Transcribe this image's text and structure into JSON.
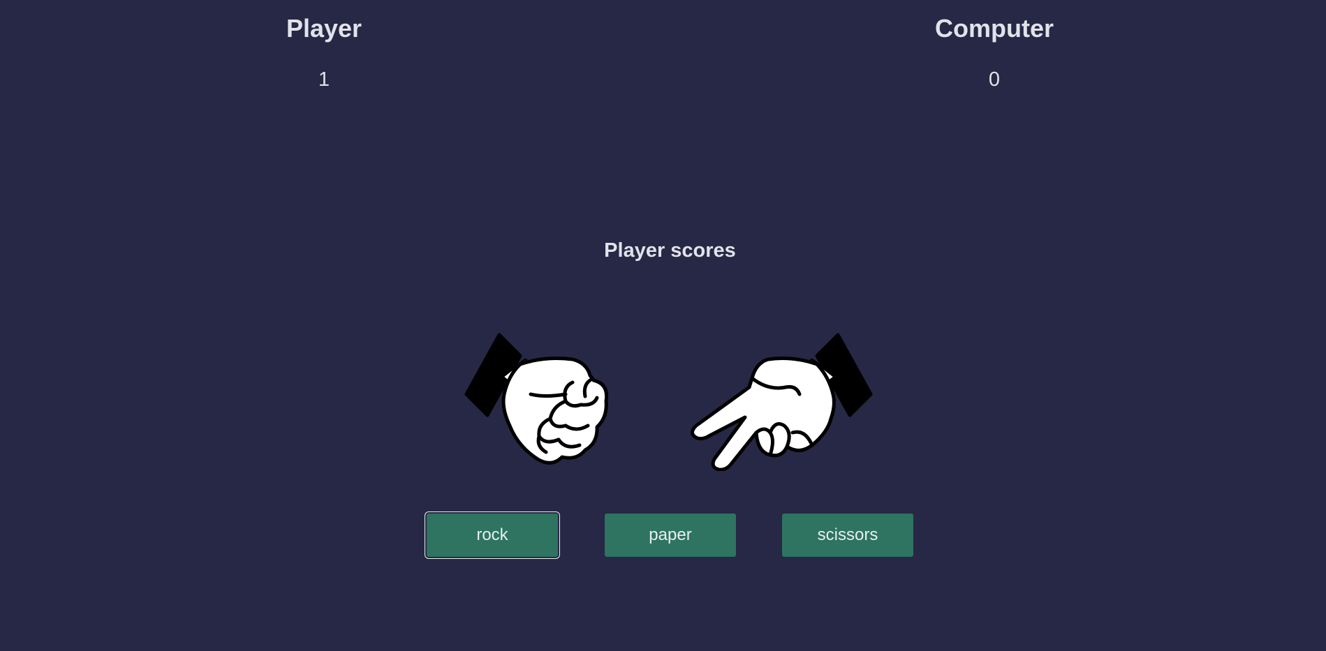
{
  "scoreboard": {
    "player_label": "Player",
    "player_score": "1",
    "computer_label": "Computer",
    "computer_score": "0"
  },
  "result_text": "Player scores",
  "hands": {
    "player": "rock-hand-icon",
    "computer": "scissors-hand-icon"
  },
  "choices": {
    "rock": "rock",
    "paper": "paper",
    "scissors": "scissors"
  },
  "colors": {
    "background": "#262845",
    "button": "#2e7460",
    "text": "#e2e2ea"
  }
}
